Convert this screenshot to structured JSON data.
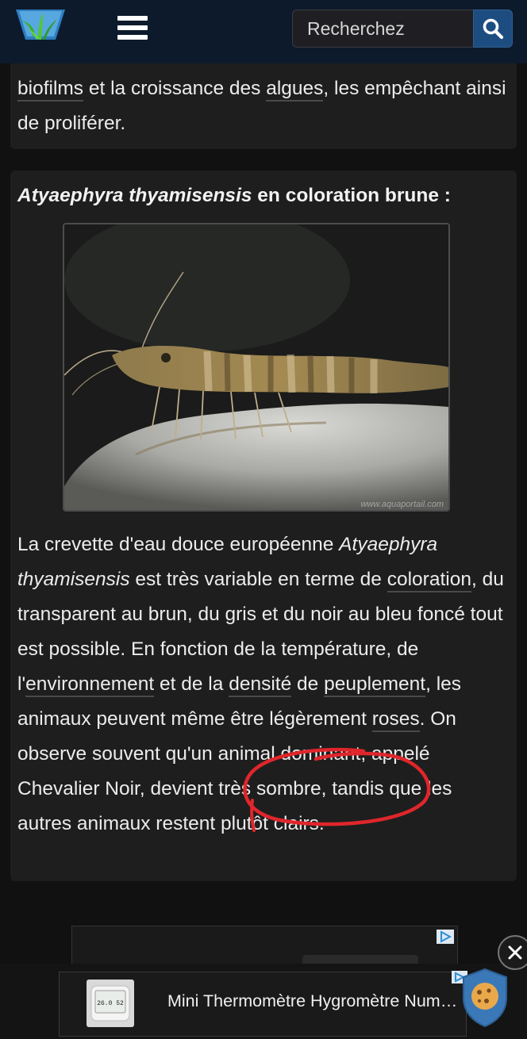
{
  "header": {
    "logo_icon": "aquarium-plant-logo-icon",
    "menu_icon": "hamburger-menu-icon",
    "search": {
      "placeholder": "Recherchez",
      "button_icon": "search-icon"
    },
    "background_color": "#0d1a2c"
  },
  "top_card": {
    "parts": [
      "",
      "biofilms",
      " et la croissance des ",
      "algues",
      ", les empêchant ainsi de proliférer."
    ]
  },
  "main_card": {
    "caption_italic": "Atyaephyra thyamisensis",
    "caption_rest": " en coloration brune :",
    "image": {
      "alt": "Atyaephyra thyamisensis brune",
      "watermark": "www.aquaportail.com"
    },
    "description": {
      "p1": "La crevette d'eau douce européenne ",
      "p2_italic": "Atyaephyra thyamisensis",
      "p3": " est très variable en terme de ",
      "p4_link": "coloration",
      "p5": ", du transparent au brun, du gris et du noir au bleu foncé tout est possible. En fonction de la température, de l'",
      "p6_link": "environnement",
      "p7": " et de la ",
      "p8_link": "densité",
      "p9": " de ",
      "p10_link": "peuplement",
      "p11": ", les animaux peuvent même être légèrement ",
      "p12_link": "roses",
      "p13": ". On observe souvent qu'un animal dominant, appelé Chevalier Noir, devient très sombre, tandis que les autres animaux restent plutôt clairs."
    },
    "annotation_color": "#e0262b"
  },
  "ad": {
    "banner_text": "Mini Thermomètre Hygromètre Numérique",
    "thumb_readout": "26.0 52",
    "close_icon": "close-icon",
    "adchoices_icon": "adchoices-icon",
    "cookie_icon": "cookie-shield-icon"
  }
}
